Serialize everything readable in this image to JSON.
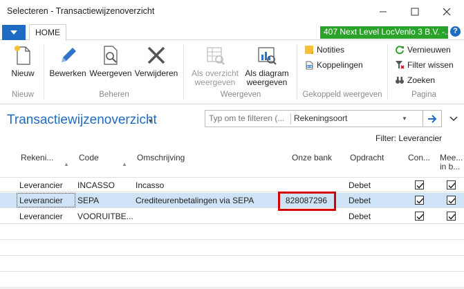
{
  "window": {
    "title": "Selecteren - Transactiewijzenoverzicht"
  },
  "ribbon": {
    "tab_home": "HOME",
    "company": "407 Next Level LocVenlo 3 B.V. -...",
    "groups": {
      "nieuw": {
        "label": "Nieuw",
        "buttons": {
          "nieuw": "Nieuw"
        }
      },
      "beheren": {
        "label": "Beheren",
        "buttons": {
          "bewerken": "Bewerken",
          "weergeven": "Weergeven",
          "verwijderen": "Verwijderen"
        }
      },
      "weergeven": {
        "label": "Weergeven",
        "buttons": {
          "overzicht_1": "Als overzicht",
          "overzicht_2": "weergeven",
          "diagram_1": "Als diagram",
          "diagram_2": "weergeven"
        }
      },
      "gekoppeld": {
        "label": "Gekoppeld weergeven",
        "buttons": {
          "notities": "Notities",
          "koppelingen": "Koppelingen"
        }
      },
      "pagina": {
        "label": "Pagina",
        "buttons": {
          "vernieuwen": "Vernieuwen",
          "filter_wissen": "Filter wissen",
          "zoeken": "Zoeken"
        }
      }
    }
  },
  "page": {
    "title": "Transactiewijzenoverzicht",
    "search_placeholder": "Typ om te filteren (...",
    "search_field": "Rekeningsoort",
    "filter": "Filter: Leverancier"
  },
  "table": {
    "columns": {
      "rekeningsoort": "Rekeni...",
      "code": "Code",
      "omschrijving": "Omschrijving",
      "onze_bank": "Onze bank",
      "opdracht": "Opdracht",
      "con_1": "Con...",
      "mee_1": "Mee...",
      "mee_2": "in b..."
    },
    "rows": [
      {
        "rekeningsoort": "Leverancier",
        "code": "INCASSO",
        "omschrijving": "Incasso",
        "onze_bank": "",
        "opdracht": "Debet",
        "con": true,
        "mee": true
      },
      {
        "rekeningsoort": "Leverancier",
        "code": "SEPA",
        "omschrijving": "Crediteurenbetalingen via SEPA",
        "onze_bank": "828087296",
        "opdracht": "Debet",
        "con": true,
        "mee": true
      },
      {
        "rekeningsoort": "Leverancier",
        "code": "VOORUITBE...",
        "omschrijving": "",
        "onze_bank": "",
        "opdracht": "Debet",
        "con": true,
        "mee": true
      }
    ]
  },
  "colors": {
    "accent": "#1e6bc4",
    "company_bg": "#2ba32b",
    "selection": "#cfe3f6",
    "highlight": "#d40000"
  }
}
